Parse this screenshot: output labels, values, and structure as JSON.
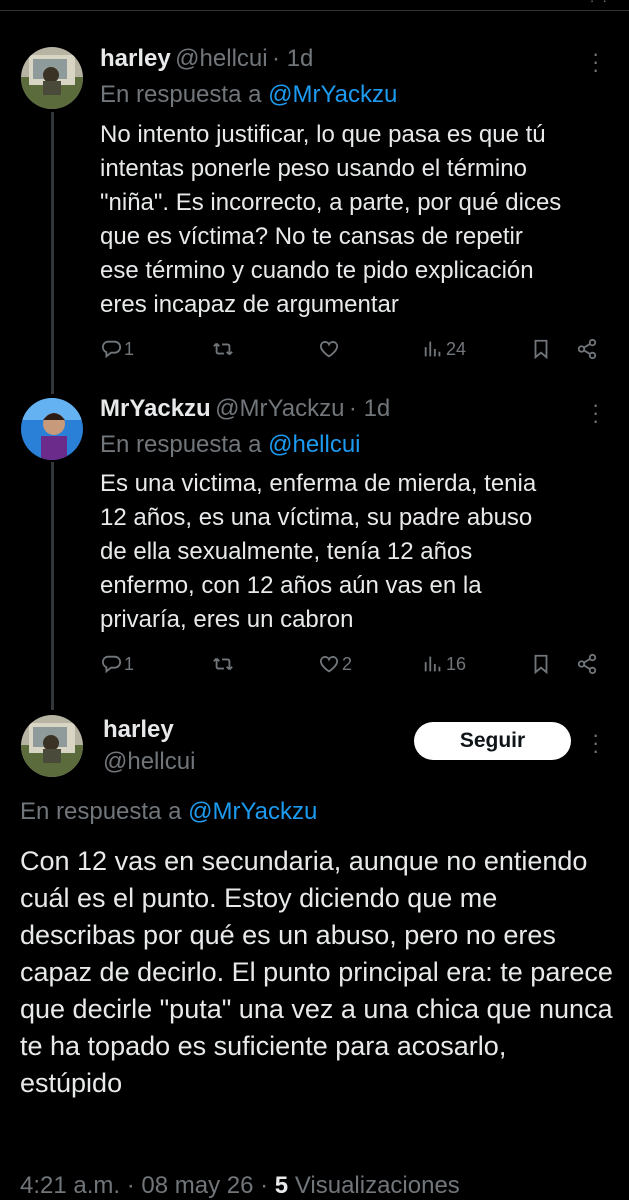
{
  "tweets": [
    {
      "name": "harley",
      "handle": "@hellcui",
      "time": "1d",
      "reply_prefix": "En respuesta a",
      "reply_to": "@MrYackzu",
      "text": "No intento justificar, lo que pasa es que tú\nintentas ponerle peso usando el término\n\"niña\". Es incorrecto, a parte, por qué dices\nque es víctima? No te cansas de repetir\nese término y cuando te pido explicación\neres incapaz de argumentar",
      "replies": "1",
      "retweets": "",
      "likes": "",
      "views": "24"
    },
    {
      "name": "MrYackzu",
      "handle": "@MrYackzu",
      "time": "1d",
      "reply_prefix": "En respuesta a",
      "reply_to": "@hellcui",
      "text": "Es una victima, enferma de mierda, tenia\n12 años,  es una víctima, su padre abuso\nde ella sexualmente, tenía 12 años\nenfermo, con 12 años aún vas en la\nprivaría, eres un cabron",
      "replies": "1",
      "retweets": "",
      "likes": "2",
      "views": "16"
    }
  ],
  "main": {
    "name": "harley",
    "handle": "@hellcui",
    "follow_label": "Seguir",
    "reply_prefix": "En respuesta a",
    "reply_to": "@MrYackzu",
    "text": "Con 12 vas en secundaria, aunque no entiendo cuál es el punto. Estoy diciendo que me describas por qué es un abuso, pero no eres capaz de decirlo. El punto principal era: te parece que decirle \"puta\" una vez a una chica que nunca te ha topado es suficiente para acosarlo, estúpido",
    "timestamp": "4:21 a.m. · 08 may 26 · ",
    "views_count": "5",
    "views_label": "Visualizaciones"
  },
  "colors": {
    "background": "#000000",
    "text": "#e7e9ea",
    "muted": "#71767b",
    "link": "#1d9bf0"
  },
  "icons": [
    "reply-icon",
    "retweet-icon",
    "like-icon",
    "views-icon",
    "bookmark-icon",
    "share-icon",
    "more-icon"
  ]
}
